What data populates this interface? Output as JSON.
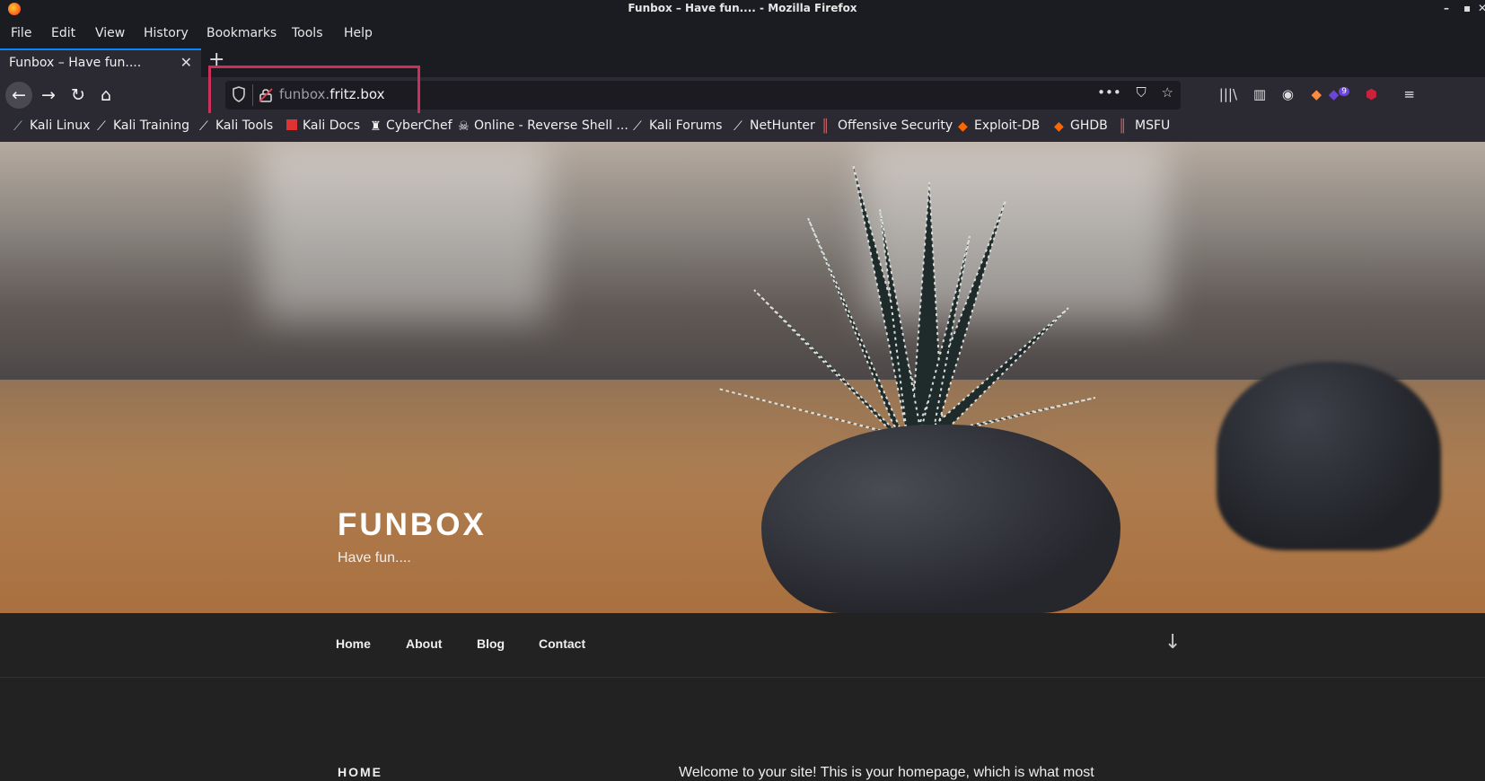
{
  "window": {
    "title": "Funbox – Have fun.... - Mozilla Firefox"
  },
  "menu": [
    "File",
    "Edit",
    "View",
    "History",
    "Bookmarks",
    "Tools",
    "Help"
  ],
  "tab": {
    "title": "Funbox – Have fun....",
    "close": "✕",
    "new": "+"
  },
  "url": {
    "subdomain": "funbox.",
    "domain": "fritz.box"
  },
  "url_actions": {
    "more": "•••"
  },
  "toolbar": {
    "badge_count": "9"
  },
  "bookmarks": [
    "Kali Linux",
    "Kali Training",
    "Kali Tools",
    "Kali Docs",
    "CyberChef",
    "Online - Reverse Shell ...",
    "Kali Forums",
    "NetHunter",
    "Offensive Security",
    "Exploit-DB",
    "GHDB",
    "MSFU"
  ],
  "site": {
    "title": "FUNBOX",
    "tagline": "Have fun....",
    "nav": [
      "Home",
      "About",
      "Blog",
      "Contact"
    ],
    "section_heading": "HOME",
    "intro": "Welcome to your site! This is your homepage, which is what most"
  },
  "colors": {
    "highlight": "#cc2f5a",
    "accent": "#0a84ff"
  }
}
